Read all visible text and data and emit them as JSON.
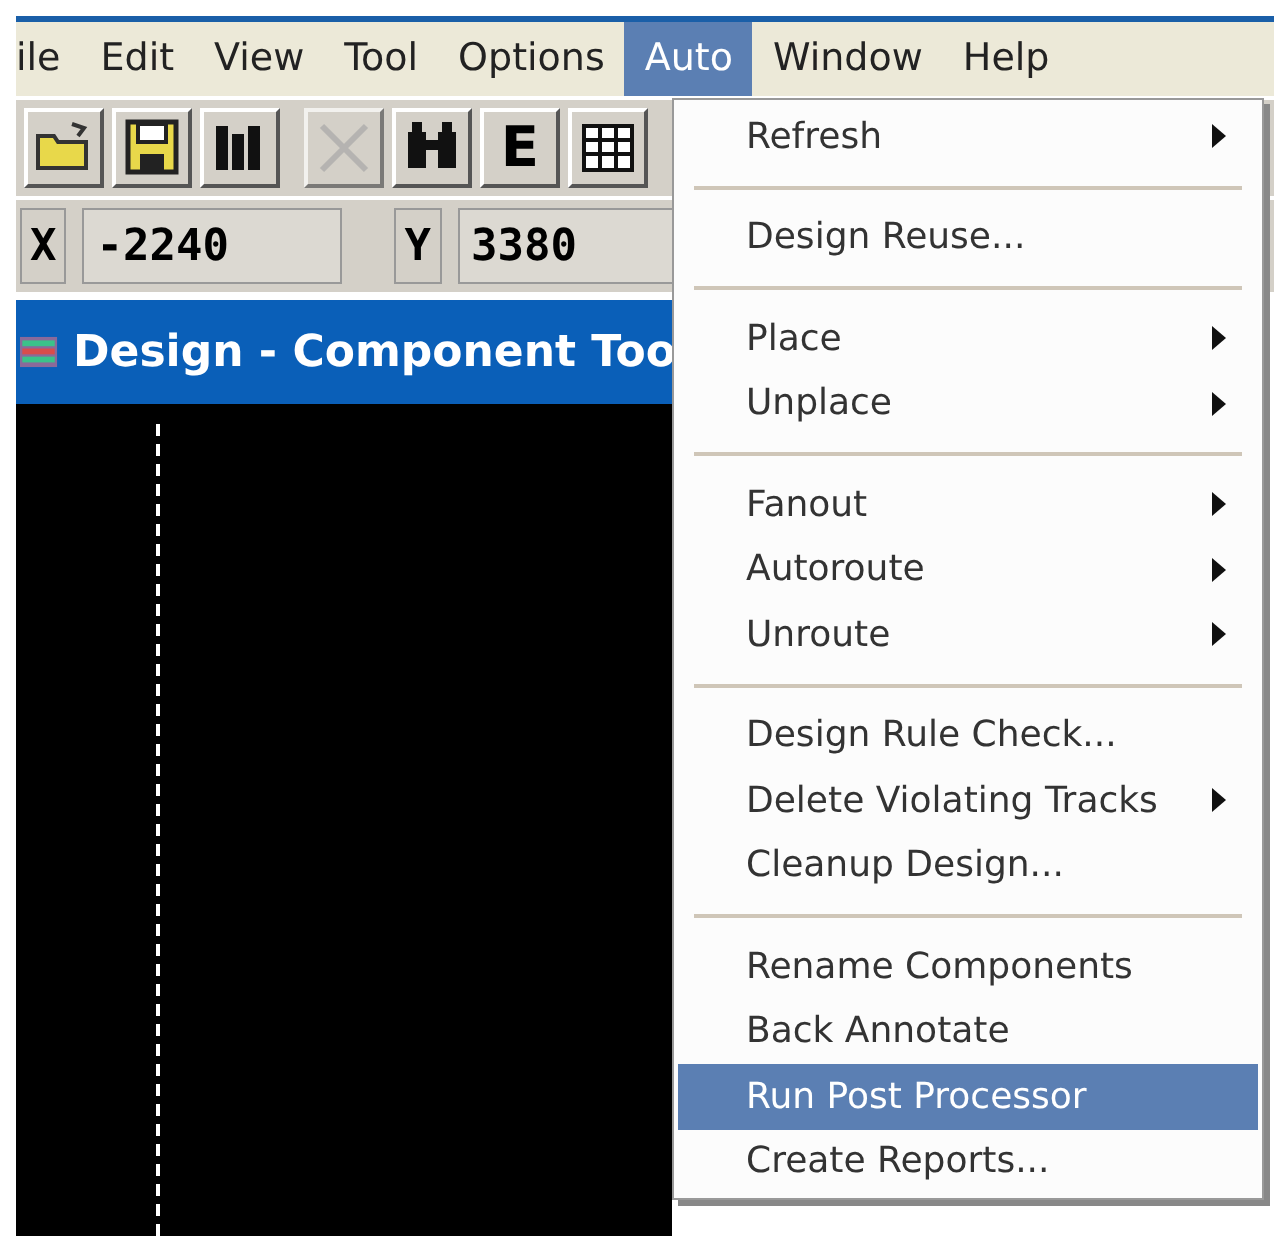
{
  "menubar": [
    {
      "label": "ile",
      "selected": false
    },
    {
      "label": "Edit",
      "selected": false
    },
    {
      "label": "View",
      "selected": false
    },
    {
      "label": "Tool",
      "selected": false
    },
    {
      "label": "Options",
      "selected": false
    },
    {
      "label": "Auto",
      "selected": true
    },
    {
      "label": "Window",
      "selected": false
    },
    {
      "label": "Help",
      "selected": false
    }
  ],
  "toolbar": [
    {
      "kind": "open",
      "disabled": false
    },
    {
      "kind": "save",
      "disabled": false
    },
    {
      "kind": "library",
      "disabled": false
    },
    {
      "kind": "delete",
      "disabled": true
    },
    {
      "kind": "find",
      "disabled": false
    },
    {
      "kind": "text",
      "label": "E",
      "disabled": false
    },
    {
      "kind": "grid",
      "disabled": false
    }
  ],
  "coordinates": [
    {
      "label": "X",
      "value": "-2240"
    },
    {
      "label": "Y",
      "value": "3380"
    }
  ],
  "document_window": {
    "title": "Design - Component Too"
  },
  "auto_menu": [
    {
      "kind": "item",
      "label": "Refresh",
      "submenu": true,
      "selected": false
    },
    {
      "kind": "separator"
    },
    {
      "kind": "item",
      "label": "Design Reuse...",
      "submenu": false,
      "selected": false
    },
    {
      "kind": "separator"
    },
    {
      "kind": "item",
      "label": "Place",
      "submenu": true,
      "selected": false
    },
    {
      "kind": "item",
      "label": "Unplace",
      "submenu": true,
      "selected": false
    },
    {
      "kind": "separator"
    },
    {
      "kind": "item",
      "label": "Fanout",
      "submenu": true,
      "selected": false
    },
    {
      "kind": "item",
      "label": "Autoroute",
      "submenu": true,
      "selected": false
    },
    {
      "kind": "item",
      "label": "Unroute",
      "submenu": true,
      "selected": false
    },
    {
      "kind": "separator"
    },
    {
      "kind": "item",
      "label": "Design Rule Check...",
      "submenu": false,
      "selected": false
    },
    {
      "kind": "item",
      "label": "Delete Violating Tracks",
      "submenu": true,
      "selected": false
    },
    {
      "kind": "item",
      "label": "Cleanup Design...",
      "submenu": false,
      "selected": false
    },
    {
      "kind": "separator"
    },
    {
      "kind": "item",
      "label": "Rename Components",
      "submenu": false,
      "selected": false
    },
    {
      "kind": "item",
      "label": "Back Annotate",
      "submenu": false,
      "selected": false
    },
    {
      "kind": "item",
      "label": "Run Post Processor",
      "submenu": false,
      "selected": true
    },
    {
      "kind": "item",
      "label": "Create Reports...",
      "submenu": false,
      "selected": false
    }
  ]
}
